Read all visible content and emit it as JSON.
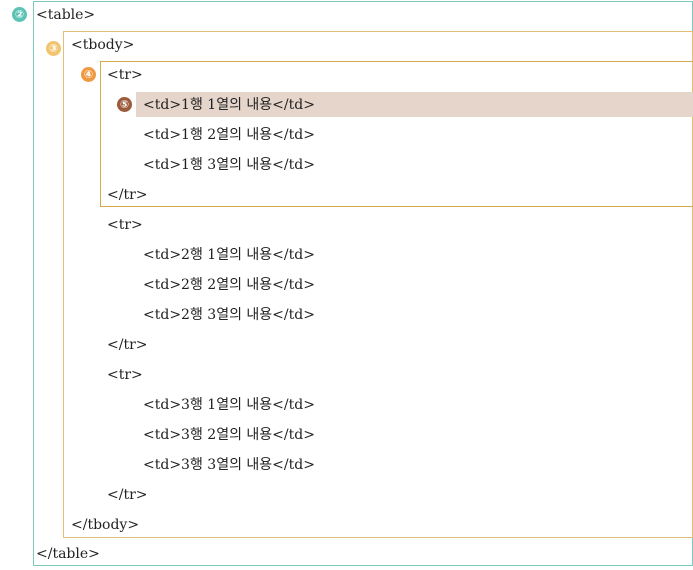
{
  "colors": {
    "table_border": "#7cc8bd",
    "tbody_border": "#e2c078",
    "tr_border": "#d3a94d",
    "td_highlight": "#e6d5cb",
    "marker_2": "#5cc3b5",
    "marker_3": "#f2c46d",
    "marker_4": "#ef9a43",
    "marker_5": "#9b5a3b"
  },
  "markers": [
    "②",
    "③",
    "④",
    "⑤"
  ],
  "lines": {
    "table_open": "<table>",
    "tbody_open": "<tbody>",
    "tr_open": "<tr>",
    "tr_close": "</tr>",
    "tbody_close": "</tbody>",
    "table_close": "</table>"
  },
  "rows": [
    {
      "cells": [
        "<td>1행 1열의 내용</td>",
        "<td>1행 2열의 내용</td>",
        "<td>1행 3열의 내용</td>"
      ]
    },
    {
      "cells": [
        "<td>2행 1열의 내용</td>",
        "<td>2행 2열의 내용</td>",
        "<td>2행 3열의 내용</td>"
      ]
    },
    {
      "cells": [
        "<td>3행 1열의 내용</td>",
        "<td>3행 2열의 내용</td>",
        "<td>3행 3열의 내용</td>"
      ]
    }
  ]
}
